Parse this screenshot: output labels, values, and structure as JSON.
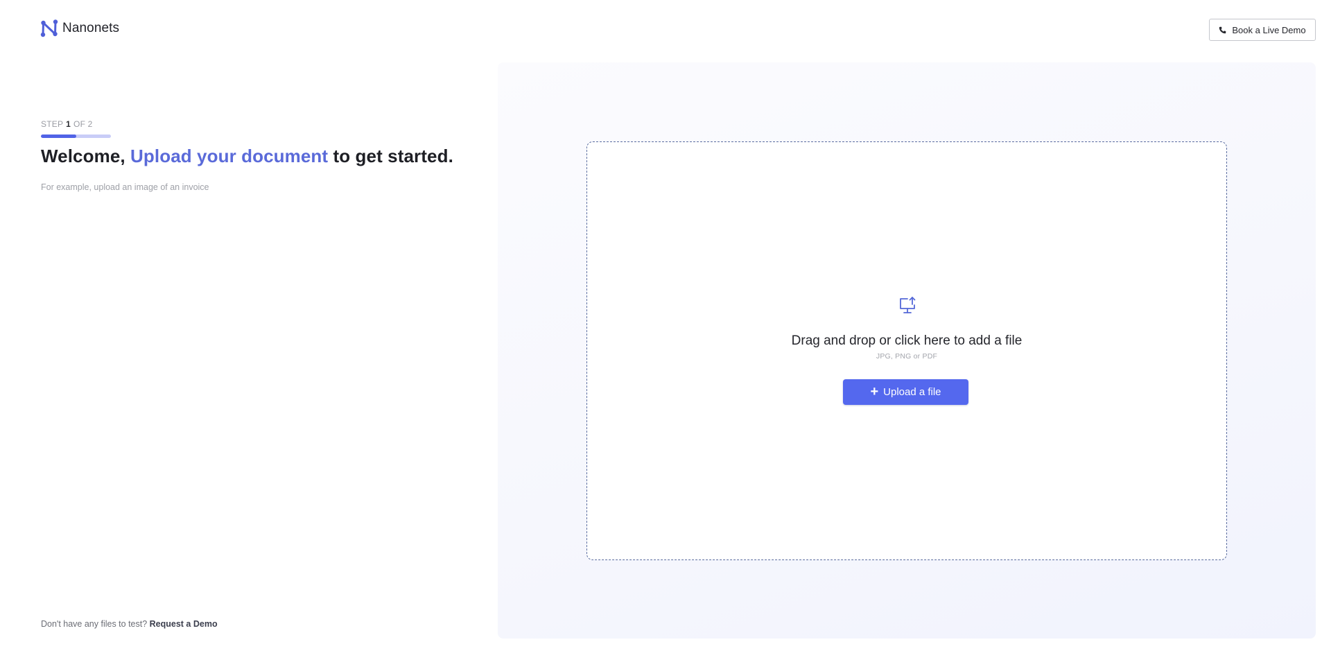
{
  "brand": {
    "name": "Nanonets",
    "accent_color": "#5468ee",
    "icon": "nanonets-logo-icon"
  },
  "header": {
    "book_demo_label": "Book a Live Demo",
    "book_demo_icon": "phone-icon"
  },
  "step": {
    "prefix": "STEP",
    "current": "1",
    "suffix": "OF 2",
    "progress": 0.5
  },
  "headline": {
    "lead": "Welcome, ",
    "accent": "Upload your document",
    "trail": " to get started."
  },
  "subtext": "For example, upload an image of an invoice",
  "dropzone": {
    "icon": "monitor-upload-icon",
    "title": "Drag and drop or click here to add a file",
    "hint": "JPG, PNG or PDF",
    "upload_button": "Upload a file"
  },
  "footer": {
    "question": "Don't have any files to test? ",
    "link": "Request a Demo"
  }
}
